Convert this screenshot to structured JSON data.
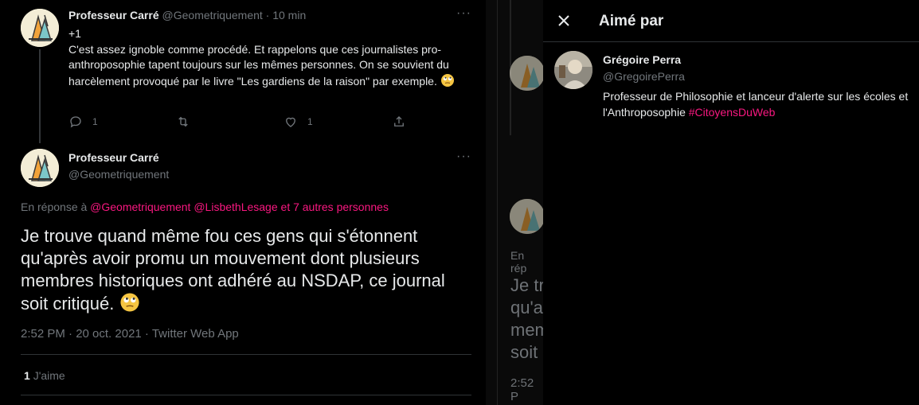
{
  "tweet1": {
    "name": "Professeur Carré",
    "handle_time": "@Geometriquement · 10 min",
    "line1": "+1",
    "body": "C'est assez ignoble comme procédé. Et rappelons que ces journalistes pro-anthroposophie tapent toujours sur les mêmes personnes. On se souvient du harcèlement provoqué par le livre \"Les gardiens de la raison\" par exemple.",
    "reply_count": "1",
    "like_count": "1"
  },
  "tweet2": {
    "name": "Professeur Carré",
    "handle": "@Geometriquement",
    "reply_prefix": "En réponse à ",
    "mention1": "@Geometriquement",
    "mention2": "@LisbethLesage",
    "mention_others": "et 7 autres personnes",
    "text": "Je trouve quand même fou ces gens qui s'étonnent qu'après avoir promu un mouvement dont plusieurs membres historiques ont adhéré au NSDAP, ce journal soit critiqué.",
    "meta": "2:52 PM · 20 oct. 2021 · Twitter Web App",
    "likes_count": "1",
    "likes_label": "J'aime"
  },
  "faded": {
    "reply_prefix": "En rép",
    "line1": "Je tr",
    "line2": "qu'a",
    "line3": "mem",
    "line4": "soit",
    "meta": "2:52 P"
  },
  "modal": {
    "title": "Aimé par",
    "user": {
      "name": "Grégoire Perra",
      "handle": "@GregoirePerra",
      "bio": "Professeur de Philosophie et lanceur d'alerte sur les écoles et l'Anthroposophie ",
      "hashtag": "#CitoyensDuWeb"
    }
  },
  "icons": [
    "more-icon",
    "reply-icon",
    "retweet-icon",
    "like-icon",
    "share-icon",
    "close-icon",
    "emoji-eyeroll-icon"
  ],
  "colors": {
    "background": "#000000",
    "text": "#e7e9ea",
    "secondary": "#71767b",
    "accent": "#f91880",
    "divider": "#2f3336"
  }
}
